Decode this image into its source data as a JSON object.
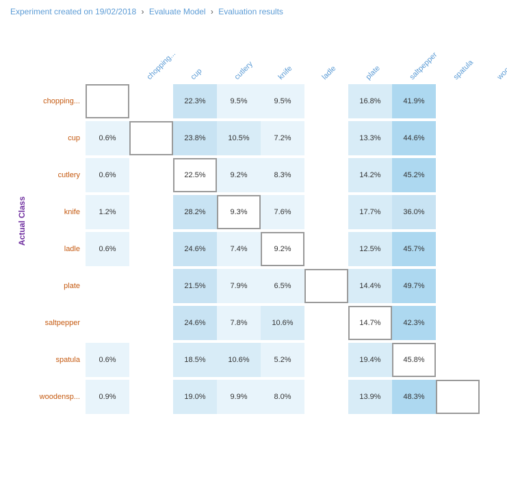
{
  "breadcrumb": {
    "part1": "Experiment created on 19/02/2018",
    "sep1": ">",
    "part2": "Evaluate Model",
    "sep2": ">",
    "part3": "Evaluation results"
  },
  "yAxisLabel": "Actual Class",
  "colHeaders": [
    "chopping...",
    "cup",
    "cutlery",
    "knife",
    "ladle",
    "plate",
    "saltpepper",
    "spatula",
    "woodensp..."
  ],
  "rowLabels": [
    "chopping...",
    "cup",
    "cutlery",
    "knife",
    "ladle",
    "plate",
    "saltpepper",
    "spatula",
    "woodensp..."
  ],
  "cells": [
    [
      "",
      "",
      "22.3%",
      "9.5%",
      "9.5%",
      "",
      "16.8%",
      "41.9%",
      ""
    ],
    [
      "0.6%",
      "",
      "23.8%",
      "10.5%",
      "7.2%",
      "",
      "13.3%",
      "44.6%",
      ""
    ],
    [
      "0.6%",
      "",
      "22.5%",
      "9.2%",
      "8.3%",
      "",
      "14.2%",
      "45.2%",
      ""
    ],
    [
      "1.2%",
      "",
      "28.2%",
      "9.3%",
      "7.6%",
      "",
      "17.7%",
      "36.0%",
      ""
    ],
    [
      "0.6%",
      "",
      "24.6%",
      "7.4%",
      "9.2%",
      "",
      "12.5%",
      "45.7%",
      ""
    ],
    [
      "",
      "",
      "21.5%",
      "7.9%",
      "6.5%",
      "",
      "14.4%",
      "49.7%",
      ""
    ],
    [
      "",
      "",
      "24.6%",
      "7.8%",
      "10.6%",
      "",
      "14.7%",
      "42.3%",
      ""
    ],
    [
      "0.6%",
      "",
      "18.5%",
      "10.6%",
      "5.2%",
      "",
      "19.4%",
      "45.8%",
      ""
    ],
    [
      "0.9%",
      "",
      "19.0%",
      "9.9%",
      "8.0%",
      "",
      "13.9%",
      "48.3%",
      ""
    ]
  ],
  "cellColors": [
    [
      "diag",
      "empty",
      "light",
      "light",
      "light",
      "empty",
      "light",
      "light",
      "empty"
    ],
    [
      "light",
      "diag",
      "light",
      "light",
      "light",
      "empty",
      "light",
      "light",
      "empty"
    ],
    [
      "light",
      "empty",
      "diag",
      "light",
      "light",
      "empty",
      "light",
      "light",
      "empty"
    ],
    [
      "light",
      "empty",
      "light",
      "diag",
      "light",
      "empty",
      "light",
      "light",
      "empty"
    ],
    [
      "light",
      "empty",
      "light",
      "light",
      "diag",
      "empty",
      "light",
      "light",
      "empty"
    ],
    [
      "empty",
      "empty",
      "light",
      "light",
      "light",
      "diag",
      "light",
      "light",
      "empty"
    ],
    [
      "empty",
      "empty",
      "light",
      "light",
      "light",
      "empty",
      "diag",
      "light",
      "empty"
    ],
    [
      "light",
      "empty",
      "light",
      "light",
      "light",
      "empty",
      "light",
      "diag",
      "empty"
    ],
    [
      "light",
      "empty",
      "light",
      "light",
      "light",
      "empty",
      "light",
      "light",
      "diag"
    ]
  ]
}
